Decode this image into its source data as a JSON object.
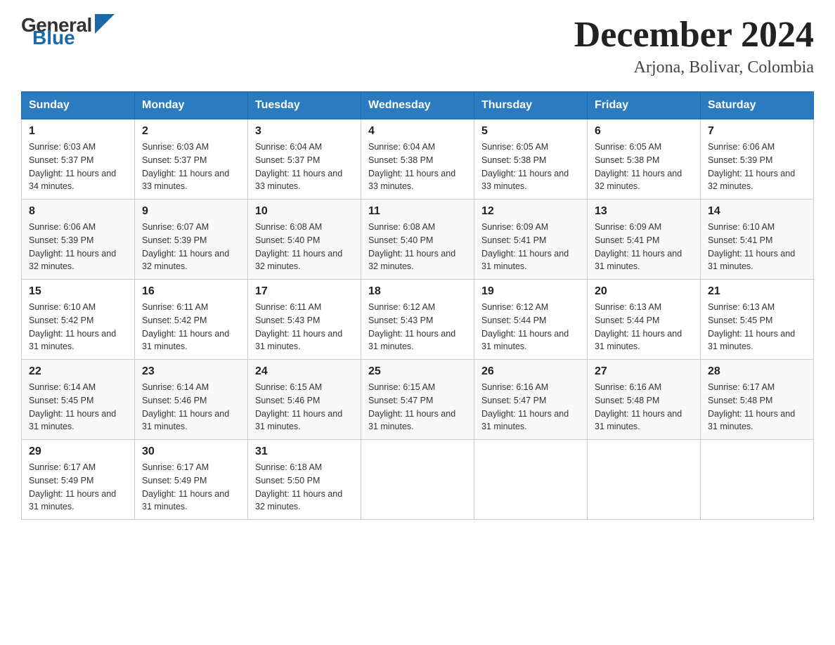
{
  "header": {
    "logo": {
      "general": "General",
      "blue": "Blue"
    },
    "month": "December 2024",
    "location": "Arjona, Bolivar, Colombia"
  },
  "weekdays": [
    "Sunday",
    "Monday",
    "Tuesday",
    "Wednesday",
    "Thursday",
    "Friday",
    "Saturday"
  ],
  "weeks": [
    [
      {
        "day": "1",
        "sunrise": "6:03 AM",
        "sunset": "5:37 PM",
        "daylight": "11 hours and 34 minutes."
      },
      {
        "day": "2",
        "sunrise": "6:03 AM",
        "sunset": "5:37 PM",
        "daylight": "11 hours and 33 minutes."
      },
      {
        "day": "3",
        "sunrise": "6:04 AM",
        "sunset": "5:37 PM",
        "daylight": "11 hours and 33 minutes."
      },
      {
        "day": "4",
        "sunrise": "6:04 AM",
        "sunset": "5:38 PM",
        "daylight": "11 hours and 33 minutes."
      },
      {
        "day": "5",
        "sunrise": "6:05 AM",
        "sunset": "5:38 PM",
        "daylight": "11 hours and 33 minutes."
      },
      {
        "day": "6",
        "sunrise": "6:05 AM",
        "sunset": "5:38 PM",
        "daylight": "11 hours and 32 minutes."
      },
      {
        "day": "7",
        "sunrise": "6:06 AM",
        "sunset": "5:39 PM",
        "daylight": "11 hours and 32 minutes."
      }
    ],
    [
      {
        "day": "8",
        "sunrise": "6:06 AM",
        "sunset": "5:39 PM",
        "daylight": "11 hours and 32 minutes."
      },
      {
        "day": "9",
        "sunrise": "6:07 AM",
        "sunset": "5:39 PM",
        "daylight": "11 hours and 32 minutes."
      },
      {
        "day": "10",
        "sunrise": "6:08 AM",
        "sunset": "5:40 PM",
        "daylight": "11 hours and 32 minutes."
      },
      {
        "day": "11",
        "sunrise": "6:08 AM",
        "sunset": "5:40 PM",
        "daylight": "11 hours and 32 minutes."
      },
      {
        "day": "12",
        "sunrise": "6:09 AM",
        "sunset": "5:41 PM",
        "daylight": "11 hours and 31 minutes."
      },
      {
        "day": "13",
        "sunrise": "6:09 AM",
        "sunset": "5:41 PM",
        "daylight": "11 hours and 31 minutes."
      },
      {
        "day": "14",
        "sunrise": "6:10 AM",
        "sunset": "5:41 PM",
        "daylight": "11 hours and 31 minutes."
      }
    ],
    [
      {
        "day": "15",
        "sunrise": "6:10 AM",
        "sunset": "5:42 PM",
        "daylight": "11 hours and 31 minutes."
      },
      {
        "day": "16",
        "sunrise": "6:11 AM",
        "sunset": "5:42 PM",
        "daylight": "11 hours and 31 minutes."
      },
      {
        "day": "17",
        "sunrise": "6:11 AM",
        "sunset": "5:43 PM",
        "daylight": "11 hours and 31 minutes."
      },
      {
        "day": "18",
        "sunrise": "6:12 AM",
        "sunset": "5:43 PM",
        "daylight": "11 hours and 31 minutes."
      },
      {
        "day": "19",
        "sunrise": "6:12 AM",
        "sunset": "5:44 PM",
        "daylight": "11 hours and 31 minutes."
      },
      {
        "day": "20",
        "sunrise": "6:13 AM",
        "sunset": "5:44 PM",
        "daylight": "11 hours and 31 minutes."
      },
      {
        "day": "21",
        "sunrise": "6:13 AM",
        "sunset": "5:45 PM",
        "daylight": "11 hours and 31 minutes."
      }
    ],
    [
      {
        "day": "22",
        "sunrise": "6:14 AM",
        "sunset": "5:45 PM",
        "daylight": "11 hours and 31 minutes."
      },
      {
        "day": "23",
        "sunrise": "6:14 AM",
        "sunset": "5:46 PM",
        "daylight": "11 hours and 31 minutes."
      },
      {
        "day": "24",
        "sunrise": "6:15 AM",
        "sunset": "5:46 PM",
        "daylight": "11 hours and 31 minutes."
      },
      {
        "day": "25",
        "sunrise": "6:15 AM",
        "sunset": "5:47 PM",
        "daylight": "11 hours and 31 minutes."
      },
      {
        "day": "26",
        "sunrise": "6:16 AM",
        "sunset": "5:47 PM",
        "daylight": "11 hours and 31 minutes."
      },
      {
        "day": "27",
        "sunrise": "6:16 AM",
        "sunset": "5:48 PM",
        "daylight": "11 hours and 31 minutes."
      },
      {
        "day": "28",
        "sunrise": "6:17 AM",
        "sunset": "5:48 PM",
        "daylight": "11 hours and 31 minutes."
      }
    ],
    [
      {
        "day": "29",
        "sunrise": "6:17 AM",
        "sunset": "5:49 PM",
        "daylight": "11 hours and 31 minutes."
      },
      {
        "day": "30",
        "sunrise": "6:17 AM",
        "sunset": "5:49 PM",
        "daylight": "11 hours and 31 minutes."
      },
      {
        "day": "31",
        "sunrise": "6:18 AM",
        "sunset": "5:50 PM",
        "daylight": "11 hours and 32 minutes."
      },
      null,
      null,
      null,
      null
    ]
  ]
}
